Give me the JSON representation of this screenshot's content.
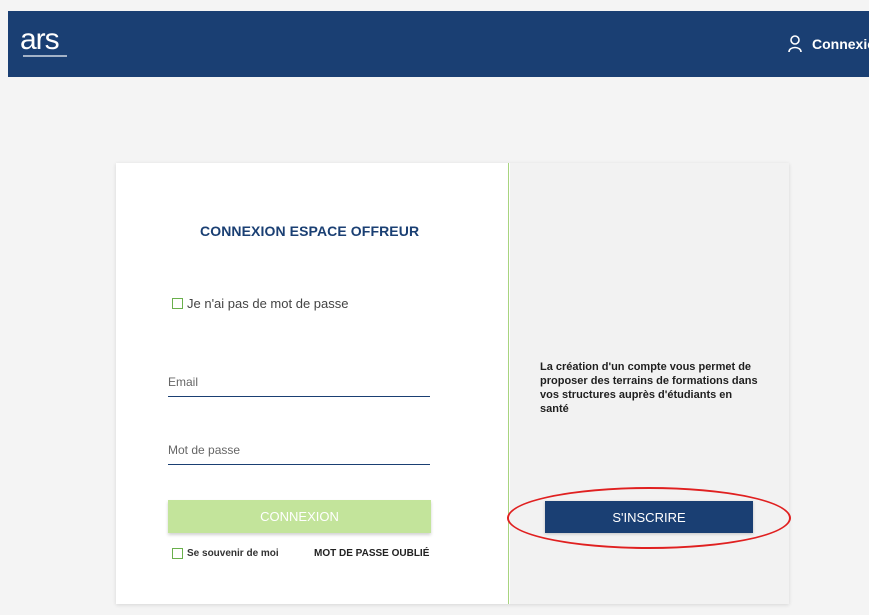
{
  "header": {
    "logo_text": "ars",
    "login_label": "Connexion",
    "user_icon": "user-icon",
    "background": "#1a3f73"
  },
  "login": {
    "title": "CONNEXION ESPACE OFFREUR",
    "no_password_label": "Je n'ai pas de mot de passe",
    "email_placeholder": "Email",
    "password_placeholder": "Mot de passe",
    "login_button": "CONNEXION",
    "remember_label": "Se souvenir de moi",
    "forgot_password": "MOT DE PASSE OUBLIÉ"
  },
  "signup": {
    "description": "La création d'un compte vous permet de proposer des terrains de formations dans vos structures auprès d'étudiants en santé",
    "button": "S'INSCRIRE"
  },
  "colors": {
    "brand": "#1a3f73",
    "success": "#c3e49b",
    "checkbox": "#6ab04c",
    "annotation": "#e02020"
  }
}
